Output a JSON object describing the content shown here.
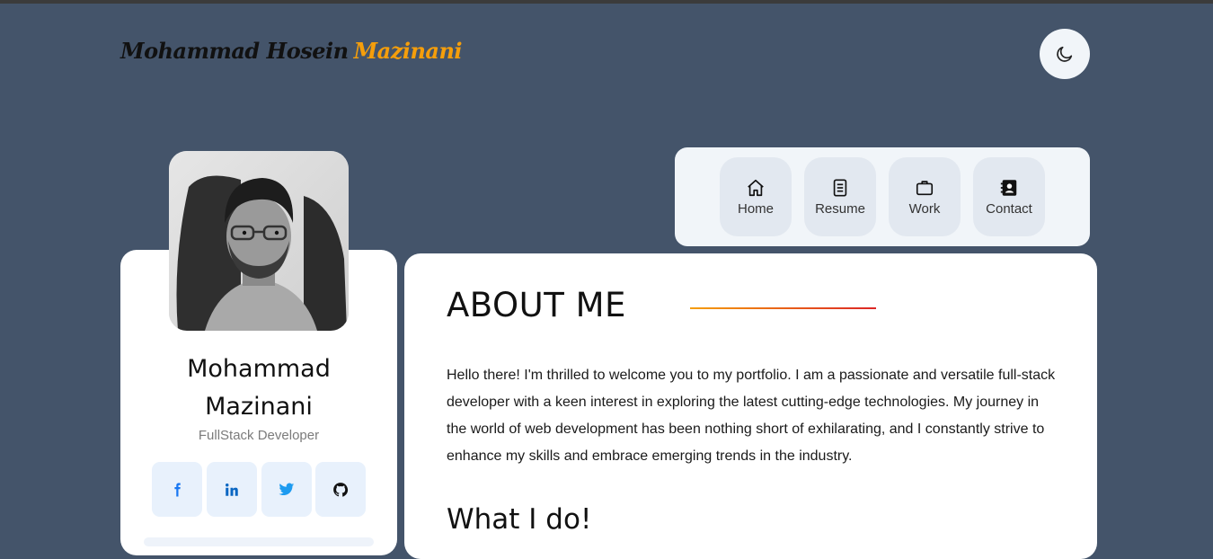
{
  "header": {
    "logo_primary": "Mohammad Hosein",
    "logo_accent": "Mazinani",
    "theme_toggle_icon": "moon-icon"
  },
  "nav": {
    "items": [
      {
        "label": "Home",
        "icon": "home-icon"
      },
      {
        "label": "Resume",
        "icon": "resume-icon"
      },
      {
        "label": "Work",
        "icon": "briefcase-icon"
      },
      {
        "label": "Contact",
        "icon": "contact-book-icon"
      }
    ]
  },
  "profile": {
    "name_line1": "Mohammad",
    "name_line2": "Mazinani",
    "role": "FullStack Developer",
    "socials": [
      {
        "icon": "facebook-icon",
        "color": "#1877f2"
      },
      {
        "icon": "linkedin-icon",
        "color": "#0a66c2"
      },
      {
        "icon": "twitter-icon",
        "color": "#1d9bf0"
      },
      {
        "icon": "github-icon",
        "color": "#111111"
      }
    ]
  },
  "about": {
    "title": "ABOUT ME",
    "paragraph": "Hello there! I'm thrilled to welcome you to my portfolio. I am a passionate and versatile full-stack developer with a keen interest in exploring the latest cutting-edge technologies. My journey in the world of web development has been nothing short of exhilarating, and I constantly strive to enhance my skills and embrace emerging trends in the industry.",
    "subheading": "What I do!"
  },
  "colors": {
    "background": "#44546a",
    "accent": "#f59e0b",
    "accent_end": "#dc2626"
  }
}
